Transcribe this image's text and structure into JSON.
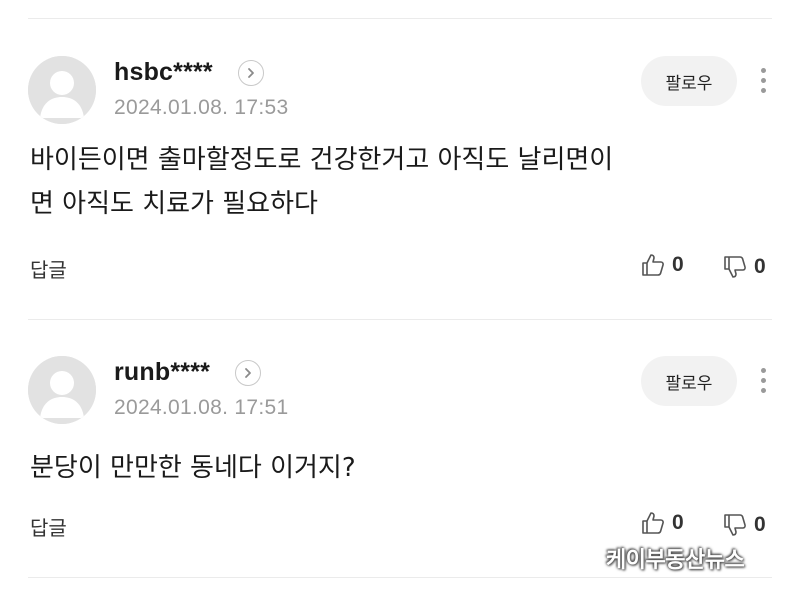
{
  "comments": [
    {
      "username": "hsbc****",
      "timestamp": "2024.01.08. 17:53",
      "follow_label": "팔로우",
      "body": "바이든이면 출마할정도로 건강한거고 아직도 날리면이\n면 아직도 치료가 필요하다",
      "reply_label": "답글",
      "likes": "0",
      "dislikes": "0"
    },
    {
      "username": "runb****",
      "timestamp": "2024.01.08. 17:51",
      "follow_label": "팔로우",
      "body": "분당이 만만한 동네다 이거지?",
      "reply_label": "답글",
      "likes": "0",
      "dislikes": "0"
    }
  ],
  "watermark": "케이부동산뉴스",
  "icons": {
    "avatar": "default-profile-icon",
    "profile_link": "chevron-right-icon",
    "more": "more-vertical-icon",
    "like": "thumbs-up-icon",
    "dislike": "thumbs-down-icon"
  }
}
